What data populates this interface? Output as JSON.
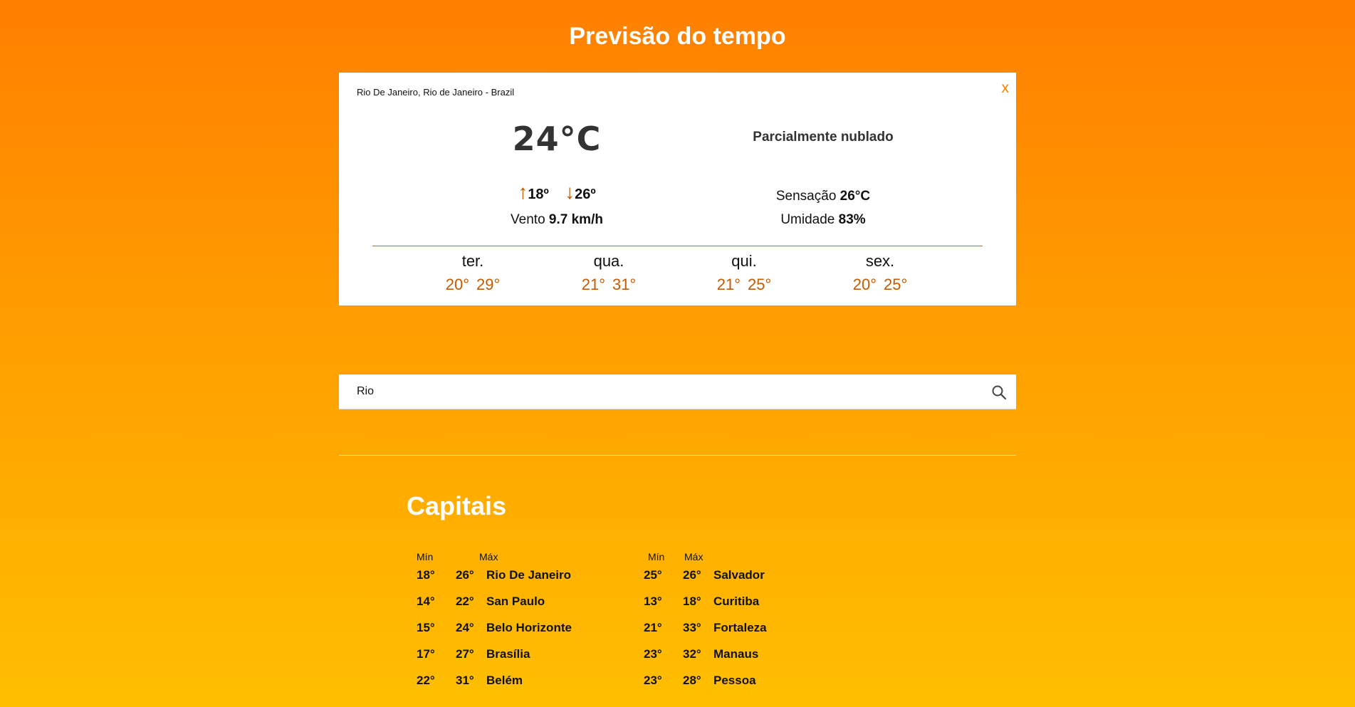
{
  "header": {
    "title": "Previsão do tempo"
  },
  "weather": {
    "location": "Rio De Janeiro, Rio de Janeiro - Brazil",
    "close_label": "x",
    "temperature": "24°C",
    "condition": "Parcialmente nublado",
    "min_arrow": "↑",
    "min": "18º",
    "max_arrow": "↓",
    "max": "26º",
    "wind_label": "Vento",
    "wind_value": "9.7 km/h",
    "feels_label": "Sensação",
    "feels_value": "26°C",
    "humidity_label": "Umidade",
    "humidity_value": "83%",
    "forecast": [
      {
        "day": "ter.",
        "min": "20°",
        "max": "29°"
      },
      {
        "day": "qua.",
        "min": "21°",
        "max": "31°"
      },
      {
        "day": "qui.",
        "min": "21°",
        "max": "25°"
      },
      {
        "day": "sex.",
        "min": "20°",
        "max": "25°"
      }
    ]
  },
  "search": {
    "value": "Rio",
    "icon": "search-icon"
  },
  "capitals": {
    "title": "Capitais",
    "min_header": "Mín",
    "max_header": "Máx",
    "columns": [
      [
        {
          "min": "18°",
          "max": "26°",
          "city": "Rio De Janeiro"
        },
        {
          "min": "14°",
          "max": "22°",
          "city": "San Paulo"
        },
        {
          "min": "15°",
          "max": "24°",
          "city": "Belo Horizonte"
        },
        {
          "min": "17°",
          "max": "27°",
          "city": "Brasília"
        },
        {
          "min": "22°",
          "max": "31°",
          "city": "Belém"
        }
      ],
      [
        {
          "min": "25°",
          "max": "26°",
          "city": "Salvador"
        },
        {
          "min": "13°",
          "max": "18°",
          "city": "Curitiba"
        },
        {
          "min": "21°",
          "max": "33°",
          "city": "Fortaleza"
        },
        {
          "min": "23°",
          "max": "32°",
          "city": "Manaus"
        },
        {
          "min": "23°",
          "max": "28°",
          "city": "Pessoa"
        }
      ]
    ]
  },
  "colors": {
    "accent": "#ff7f00",
    "forecast_temp": "#c65a00",
    "background_top": "#ff7f00",
    "background_bottom": "#ffbf00"
  }
}
